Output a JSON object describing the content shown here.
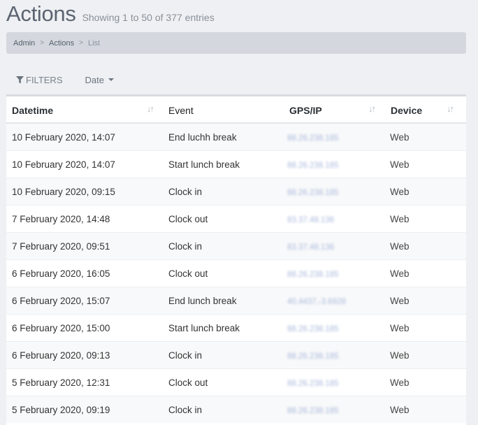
{
  "page": {
    "title": "Actions",
    "subtitle": "Showing 1 to 50 of 377 entries"
  },
  "breadcrumb": [
    "Admin",
    "Actions",
    "List"
  ],
  "toolbar": {
    "filters_label": "FILTERS",
    "date_label": "Date"
  },
  "table": {
    "columns": [
      "Datetime",
      "Event",
      "GPS/IP",
      "Device"
    ],
    "rows": [
      [
        "10 February 2020, 14:07",
        "End luchh break",
        "88.26.238.185",
        "Web"
      ],
      [
        "10 February 2020, 14:07",
        "Start lunch break",
        "88.26.238.185",
        "Web"
      ],
      [
        "10 February 2020, 09:15",
        "Clock in",
        "88.26.238.185",
        "Web"
      ],
      [
        "7 February 2020, 14:48",
        "Clock out",
        "83.37.48.136",
        "Web"
      ],
      [
        "7 February 2020, 09:51",
        "Clock in",
        "83.37.48.136",
        "Web"
      ],
      [
        "6 February 2020, 16:05",
        "Clock out",
        "88.26.238.185",
        "Web"
      ],
      [
        "6 February 2020, 15:07",
        "End lunch break",
        "40.4437,-3.6928",
        "Web"
      ],
      [
        "6 February 2020, 15:00",
        "Start lunch break",
        "88.26.238.185",
        "Web"
      ],
      [
        "6 February 2020, 09:13",
        "Clock in",
        "88.26.238.185",
        "Web"
      ],
      [
        "5 February 2020, 12:31",
        "Clock out",
        "88.26.238.185",
        "Web"
      ],
      [
        "5 February 2020, 09:19",
        "Clock in",
        "88.26.238.185",
        "Web"
      ]
    ]
  },
  "icons": {
    "filter": "filter-icon",
    "sort": "sort-icon",
    "dropdown": "caret-down-icon"
  },
  "colors": {
    "background": "#eef0f3",
    "breadcrumb_bg": "#d4d8de",
    "title": "#5c6470",
    "blurred_ip": "#a9b8dc"
  }
}
